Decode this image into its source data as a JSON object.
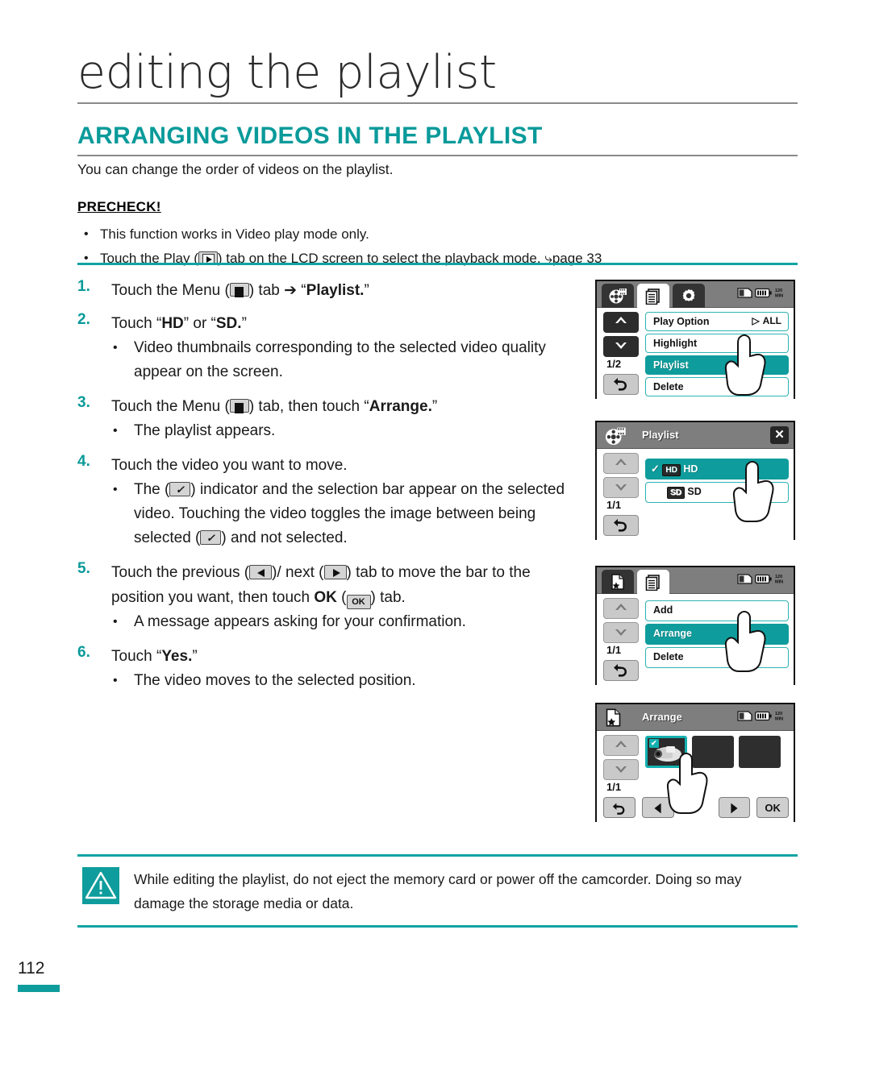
{
  "document": {
    "chapter_title": "editing the playlist",
    "section_title": "ARRANGING VIDEOS IN THE PLAYLIST",
    "intro": "You can change the order of videos on the playlist.",
    "page_number": "112"
  },
  "precheck": {
    "heading": "PRECHECK!",
    "items": [
      "This function works in Video play mode only.",
      "Touch the Play (▶) tab on the LCD screen to select the playback mode. ↪page 33"
    ],
    "item2_pre": "Touch the Play (",
    "item2_post": ") tab on the LCD screen to select the playback mode. ",
    "item2_ref": "page 33"
  },
  "steps": [
    {
      "num": "1.",
      "pre": "Touch the Menu (",
      "post": ") tab ➔ “",
      "bold": "Playlist.",
      "tail": "”",
      "subs": []
    },
    {
      "num": "2.",
      "pre": "Touch “",
      "bold": "HD",
      "mid": "” or “",
      "bold2": "SD.",
      "tail": "”",
      "subs": [
        "Video thumbnails corresponding to the selected video quality appear on the screen."
      ]
    },
    {
      "num": "3.",
      "pre": "Touch the Menu (",
      "post": ") tab, then touch “",
      "bold": "Arrange.",
      "tail": "”",
      "subs": [
        "The playlist appears."
      ]
    },
    {
      "num": "4.",
      "text": "Touch the video you want to move.",
      "sub_pre": "The (",
      "sub_mid": ") indicator and the selection bar appear on the selected video. Touching the video toggles the image between being selected (",
      "sub_post": ") and not selected."
    },
    {
      "num": "5.",
      "pre": "Touch the previous (",
      "mid": ")/ next (",
      "mid2": ") tab to move the bar to the position you want, then touch ",
      "bold": "OK",
      "mid3": " (",
      "tail": ") tab.",
      "subs": [
        "A message appears asking for your confirmation."
      ]
    },
    {
      "num": "6.",
      "pre": "Touch “",
      "bold": "Yes.",
      "tail": "”",
      "subs": [
        "The video moves to the selected position."
      ]
    }
  ],
  "lcd_screens": [
    {
      "id": "menu-playlist",
      "tabs": [
        "film-reel-icon",
        "menu-icon",
        "gear-icon"
      ],
      "active_tab": "menu-icon",
      "status_icons": [
        "memory-card-icon",
        "battery-icon",
        "quality-icon"
      ],
      "page_indicator": "1/2",
      "rows": [
        {
          "label": "Play Option",
          "right": "ALL",
          "right_arrow": "▷",
          "selected": false
        },
        {
          "label": "Highlight",
          "selected": false
        },
        {
          "label": "Playlist",
          "selected": true
        },
        {
          "label": "Delete",
          "selected": false
        }
      ],
      "hand_on_row": 2
    },
    {
      "id": "playlist-quality",
      "title": "Playlist",
      "title_icon": "film-reel-icon",
      "close_label": "✕",
      "page_indicator": "1/1",
      "rows": [
        {
          "label": "HD",
          "badge": "HD",
          "checked": true,
          "selected": true
        },
        {
          "label": "SD",
          "badge": "SD",
          "checked": false,
          "selected": false
        }
      ],
      "hand_on_row": 0
    },
    {
      "id": "playlist-menu",
      "tabs": [
        "playlist-star-icon",
        "menu-icon"
      ],
      "active_tab": "menu-icon",
      "status_icons": [
        "memory-card-icon",
        "battery-icon",
        "quality-icon"
      ],
      "page_indicator": "1/1",
      "rows": [
        {
          "label": "Add",
          "selected": false
        },
        {
          "label": "Arrange",
          "selected": true
        },
        {
          "label": "Delete",
          "selected": false
        }
      ],
      "hand_on_row": 1
    },
    {
      "id": "arrange-thumbnails",
      "title": "Arrange",
      "title_icon": "playlist-star-icon",
      "status_icons": [
        "memory-card-icon",
        "battery-icon",
        "quality-icon"
      ],
      "page_indicator": "1/1",
      "thumbnails": [
        {
          "selected": true,
          "badge": "✔",
          "content": "camcorder-image"
        },
        {
          "selected": false
        },
        {
          "selected": false
        }
      ],
      "buttons": [
        {
          "name": "return-button",
          "glyph": "↩"
        },
        {
          "name": "previous-button",
          "glyph": "◀"
        },
        {
          "name": "next-button",
          "glyph": "▶"
        },
        {
          "name": "ok-button",
          "glyph": "OK"
        }
      ],
      "hand_on_thumb": 0
    }
  ],
  "caution": {
    "icon": "warning-triangle-icon",
    "text": "While editing the playlist, do not eject the memory card or power off the camcorder. Doing so may damage the storage media or data."
  },
  "colors": {
    "accent_teal": "#0a9a9a",
    "rule_teal": "#13a3a3",
    "selected_row": "#0f9c9c",
    "lcd_header_grey": "#7e7e7e"
  }
}
